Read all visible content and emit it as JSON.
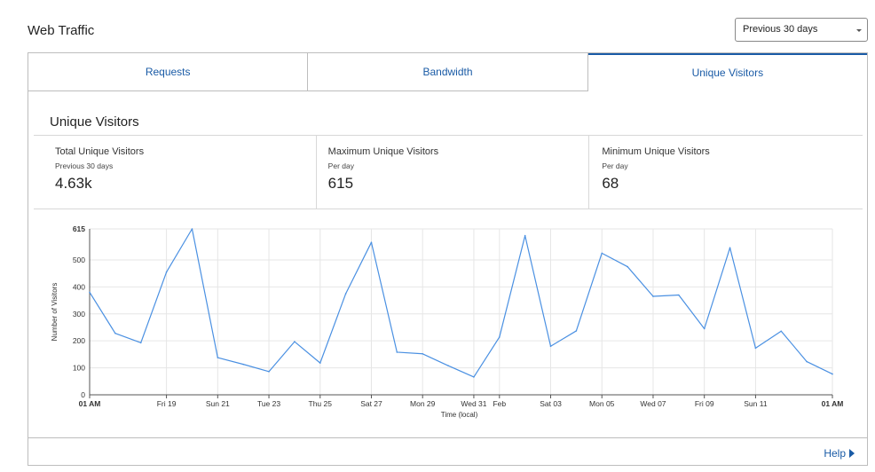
{
  "header": {
    "title": "Web Traffic",
    "range_select": {
      "value": "Previous 30 days"
    }
  },
  "tabs": [
    {
      "label": "Requests",
      "active": false
    },
    {
      "label": "Bandwidth",
      "active": false
    },
    {
      "label": "Unique Visitors",
      "active": true
    }
  ],
  "section": {
    "title": "Unique Visitors",
    "stats": [
      {
        "label": "Total Unique Visitors",
        "sub": "Previous 30 days",
        "value": "4.63k"
      },
      {
        "label": "Maximum Unique Visitors",
        "sub": "Per day",
        "value": "615"
      },
      {
        "label": "Minimum Unique Visitors",
        "sub": "Per day",
        "value": "68"
      }
    ]
  },
  "chart_data": {
    "type": "line",
    "ylabel": "Number of Visitors",
    "xlabel": "Time (local)",
    "ylim": [
      0,
      615
    ],
    "yticks": [
      0,
      100,
      200,
      300,
      400,
      500,
      615
    ],
    "grid": true,
    "line_color": "#4a90e2",
    "x_days": [
      0,
      1,
      2,
      3,
      4,
      5,
      6,
      7,
      8,
      9,
      10,
      11,
      12,
      13,
      14,
      15,
      16,
      17,
      18,
      19,
      20,
      21,
      22,
      23,
      24,
      25,
      26,
      27,
      28,
      29
    ],
    "values": [
      380,
      228,
      193,
      455,
      615,
      138,
      113,
      86,
      197,
      118,
      375,
      565,
      158,
      152,
      108,
      66,
      214,
      590,
      180,
      237,
      525,
      475,
      365,
      370,
      245,
      545,
      173,
      236,
      123,
      77
    ],
    "x_tick_labels": [
      {
        "day": 0,
        "label": "01 AM",
        "bold": true
      },
      {
        "day": 3,
        "label": "Fri 19",
        "bold": false
      },
      {
        "day": 5,
        "label": "Sun 21",
        "bold": false
      },
      {
        "day": 7,
        "label": "Tue 23",
        "bold": false
      },
      {
        "day": 9,
        "label": "Thu 25",
        "bold": false
      },
      {
        "day": 11,
        "label": "Sat 27",
        "bold": false
      },
      {
        "day": 13,
        "label": "Mon 29",
        "bold": false
      },
      {
        "day": 15,
        "label": "Wed 31",
        "bold": false
      },
      {
        "day": 16,
        "label": "Feb",
        "bold": false
      },
      {
        "day": 18,
        "label": "Sat 03",
        "bold": false
      },
      {
        "day": 20,
        "label": "Mon 05",
        "bold": false
      },
      {
        "day": 22,
        "label": "Wed 07",
        "bold": false
      },
      {
        "day": 24,
        "label": "Fri 09",
        "bold": false
      },
      {
        "day": 26,
        "label": "Sun 11",
        "bold": false
      },
      {
        "day": 29,
        "label": "01 AM",
        "bold": true
      }
    ]
  },
  "footer": {
    "help_label": "Help"
  }
}
